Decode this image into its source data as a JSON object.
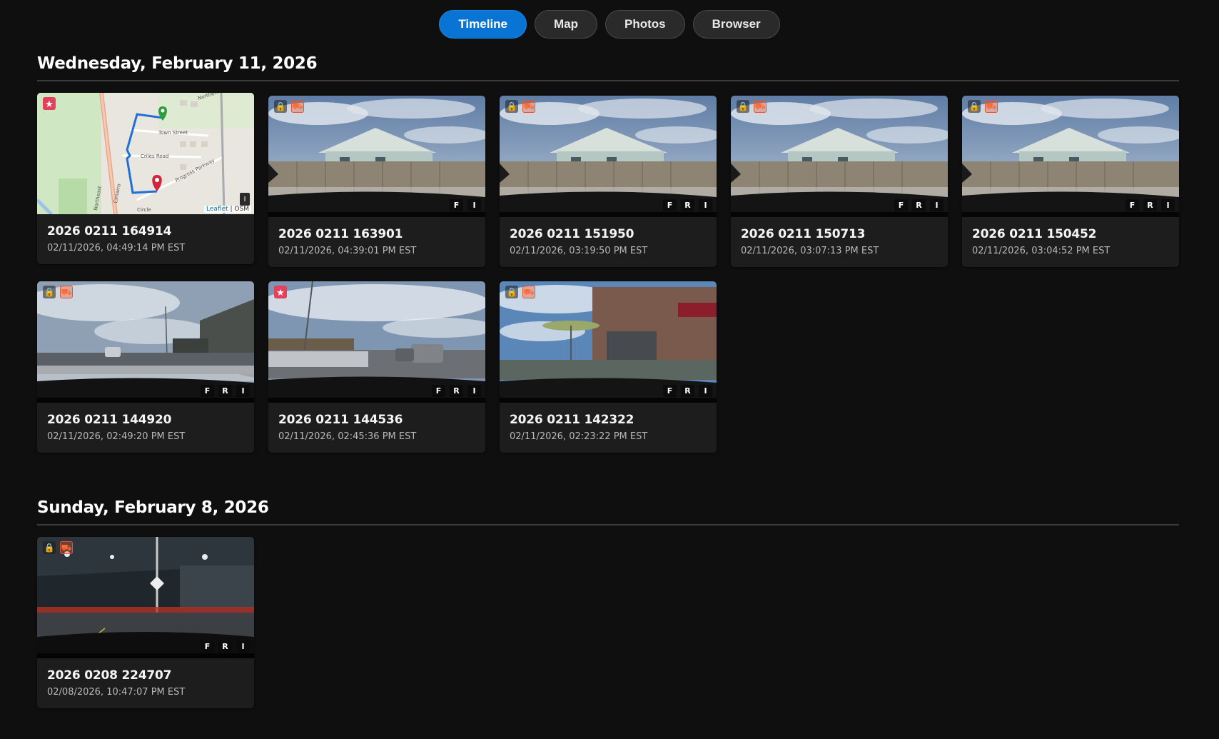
{
  "nav": {
    "tabs": [
      {
        "label": "Timeline",
        "active": true
      },
      {
        "label": "Map",
        "active": false
      },
      {
        "label": "Photos",
        "active": false
      },
      {
        "label": "Browser",
        "active": false
      }
    ]
  },
  "sections": [
    {
      "date": "Wednesday, February 11, 2026",
      "cards": [
        {
          "title": "2026 0211 164914",
          "subtitle": "02/11/2026, 04:49:14 PM EST",
          "thumb": "map",
          "badges": [
            "star-icon"
          ],
          "cameras": []
        },
        {
          "title": "2026 0211 163901",
          "subtitle": "02/11/2026, 04:39:01 PM EST",
          "thumb": "house",
          "badges": [
            "lock-icon",
            "car-icon"
          ],
          "cameras": [
            "F",
            "I"
          ]
        },
        {
          "title": "2026 0211 151950",
          "subtitle": "02/11/2026, 03:19:50 PM EST",
          "thumb": "house",
          "badges": [
            "lock-icon",
            "car-icon"
          ],
          "cameras": [
            "F",
            "R",
            "I"
          ]
        },
        {
          "title": "2026 0211 150713",
          "subtitle": "02/11/2026, 03:07:13 PM EST",
          "thumb": "house",
          "badges": [
            "lock-icon",
            "car-icon"
          ],
          "cameras": [
            "F",
            "R",
            "I"
          ]
        },
        {
          "title": "2026 0211 150452",
          "subtitle": "02/11/2026, 03:04:52 PM EST",
          "thumb": "house",
          "badges": [
            "lock-icon",
            "car-icon"
          ],
          "cameras": [
            "F",
            "R",
            "I"
          ]
        },
        {
          "title": "2026 0211 144920",
          "subtitle": "02/11/2026, 02:49:20 PM EST",
          "thumb": "lot",
          "badges": [
            "lock-icon",
            "car-icon"
          ],
          "cameras": [
            "F",
            "R",
            "I"
          ]
        },
        {
          "title": "2026 0211 144536",
          "subtitle": "02/11/2026, 02:45:36 PM EST",
          "thumb": "road",
          "badges": [
            "star-icon"
          ],
          "cameras": [
            "F",
            "R",
            "I"
          ]
        },
        {
          "title": "2026 0211 142322",
          "subtitle": "02/11/2026, 02:23:22 PM EST",
          "thumb": "store",
          "badges": [
            "lock-icon",
            "car-icon"
          ],
          "cameras": [
            "F",
            "R",
            "I"
          ]
        }
      ]
    },
    {
      "date": "Sunday, February 8, 2026",
      "cards": [
        {
          "title": "2026 0208 224707",
          "subtitle": "02/08/2026, 10:47:07 PM EST",
          "thumb": "night",
          "badges": [
            "lock-icon",
            "car-icon"
          ],
          "cameras": [
            "F",
            "R",
            "I"
          ]
        }
      ]
    }
  ],
  "map": {
    "street_labels": [
      "Town Street",
      "Criles Road",
      "Progress Parkway",
      "Northern District",
      "Northeast",
      "Circle",
      "Cimarro"
    ],
    "attribution_link": "Leaflet",
    "attribution_rest": " | OSM",
    "layer_control": "I",
    "route_color": "#1f6fd6",
    "start_marker_color": "#2e9e3a",
    "end_marker_color": "#d0253a"
  },
  "colors": {
    "accent": "#0a74d4",
    "lock": "#f2c230",
    "event": "#e8542a",
    "star": "#e2415c"
  }
}
